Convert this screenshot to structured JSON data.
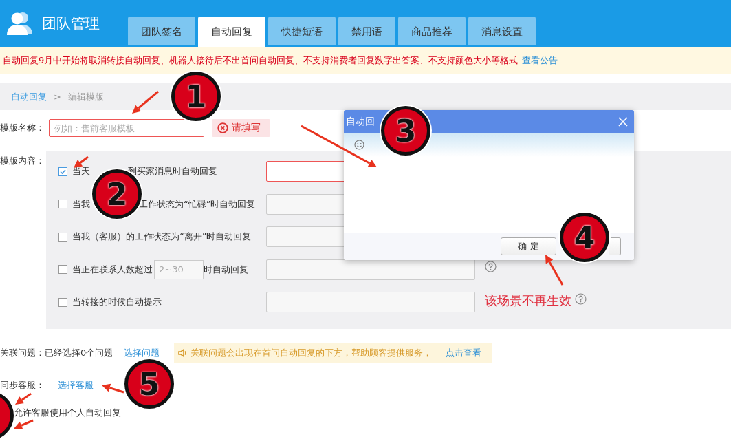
{
  "header": {
    "title": "团队管理",
    "tabs": [
      {
        "label": "团队签名",
        "selected": false
      },
      {
        "label": "自动回复",
        "selected": true
      },
      {
        "label": "快捷短语",
        "selected": false
      },
      {
        "label": "禁用语",
        "selected": false
      },
      {
        "label": "商品推荐",
        "selected": false
      },
      {
        "label": "消息设置",
        "selected": false
      }
    ]
  },
  "notice": {
    "text": "自动回复9月中开始将取消转接自动回复、机器人接待后不出首问自动回复、不支持消费者回复数字出答案、不支持颜色大小等格式",
    "link": "查看公告"
  },
  "breadcrumb": {
    "parent": "自动回复",
    "separator": ">",
    "current": "编辑模版"
  },
  "template_name": {
    "label": "模版名称：",
    "placeholder": "例如：售前客服模板",
    "error": "请填写"
  },
  "template_content": {
    "label": "模版内容：",
    "rules": [
      {
        "kind": "plain",
        "checked": true,
        "invalid": true,
        "label_parts": [
          "当天",
          "到买家消息时自动回复"
        ]
      },
      {
        "kind": "plain",
        "checked": false,
        "invalid": false,
        "label_parts": [
          "当我",
          "工作状态为“忙碌”时自动回复"
        ]
      },
      {
        "kind": "plain",
        "checked": false,
        "invalid": false,
        "label_parts": [
          "当我（客服）的工作状态为“离开”时自动回复"
        ]
      },
      {
        "kind": "threshold",
        "checked": false,
        "invalid": false,
        "label_parts": [
          "当正在联系人数超过"
        ],
        "threshold_placeholder": "2~30",
        "suffix": "时自动回复",
        "help": true
      },
      {
        "kind": "plain",
        "checked": false,
        "invalid": false,
        "label_parts": [
          "当转接的时候自动提示"
        ],
        "note": "该场景不再生效",
        "help": true
      }
    ]
  },
  "related": {
    "label": "关联问题：",
    "status": "已经选择0个问题",
    "link": "选择问题",
    "tip": "关联问题会出现在首问自动回复的下方，帮助顾客提供服务，",
    "tip_link": "点击查看"
  },
  "sync": {
    "label": "同步客服：",
    "link": "选择客服"
  },
  "allow": {
    "label": "允许客服使用个人自动回复"
  },
  "dialog": {
    "title": "自动回",
    "ok": "确 定"
  },
  "annotations": [
    {
      "label": "1"
    },
    {
      "label": "2"
    },
    {
      "label": "3"
    },
    {
      "label": "4"
    },
    {
      "label": "5"
    }
  ]
}
